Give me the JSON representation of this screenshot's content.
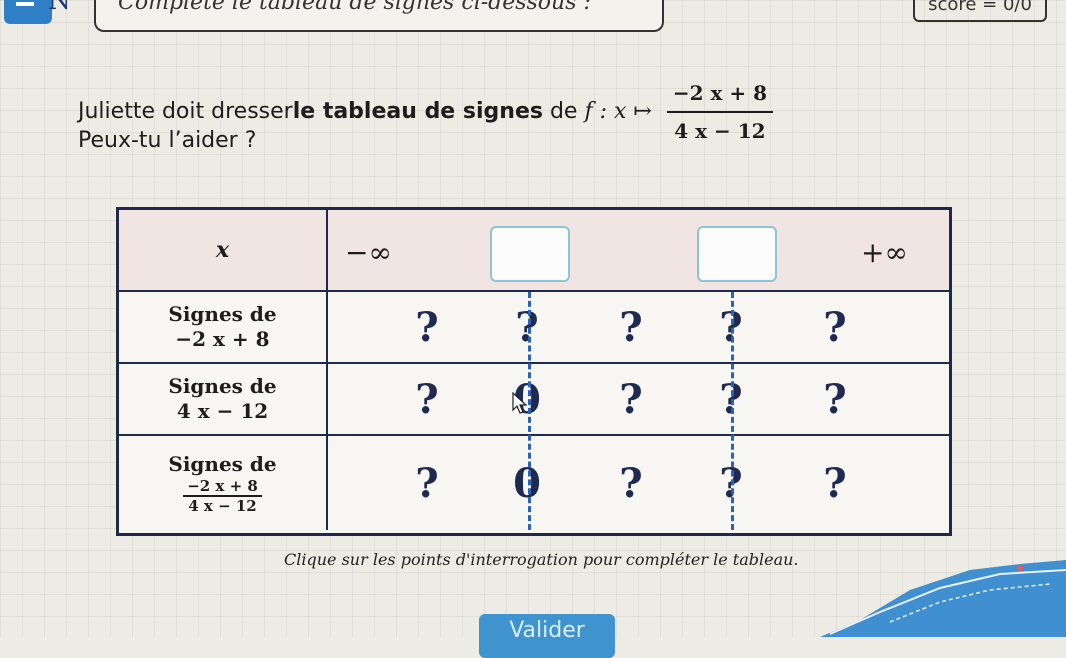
{
  "header": {
    "instruction": "Complète le tableau de signes ci-dessous :",
    "score_text": "score = 0/0",
    "logo_letter": "N"
  },
  "question": {
    "intro": "Juliette doit dresser ",
    "bold": "le tableau de signes",
    "after": " de ",
    "func": "f : x ↦ ",
    "numerator": "−2 x + 8",
    "denominator": "4 x − 12",
    "help": "Peux-tu l’aider ?"
  },
  "table": {
    "x_label": "x",
    "minus_inf": "−∞",
    "plus_inf": "+∞",
    "row1_label_a": "Signes de",
    "row1_label_b": "−2 x + 8",
    "row2_label_a": "Signes de",
    "row2_label_b": "4 x − 12",
    "row3_label_a": "Signes de",
    "row3_num": "−2 x + 8",
    "row3_den": "4 x − 12",
    "rows": [
      [
        "?",
        "?",
        "?",
        "?",
        "?"
      ],
      [
        "?",
        "0",
        "?",
        "?",
        "?"
      ],
      [
        "?",
        "0",
        "?",
        "?",
        "?"
      ]
    ]
  },
  "hint": "Clique sur les points d'interrogation pour compléter le tableau.",
  "validate_label": "Valider",
  "colors": {
    "accent": "#3f93cf",
    "dash": "#2b62b8",
    "header_row": "#f0e5e3"
  }
}
